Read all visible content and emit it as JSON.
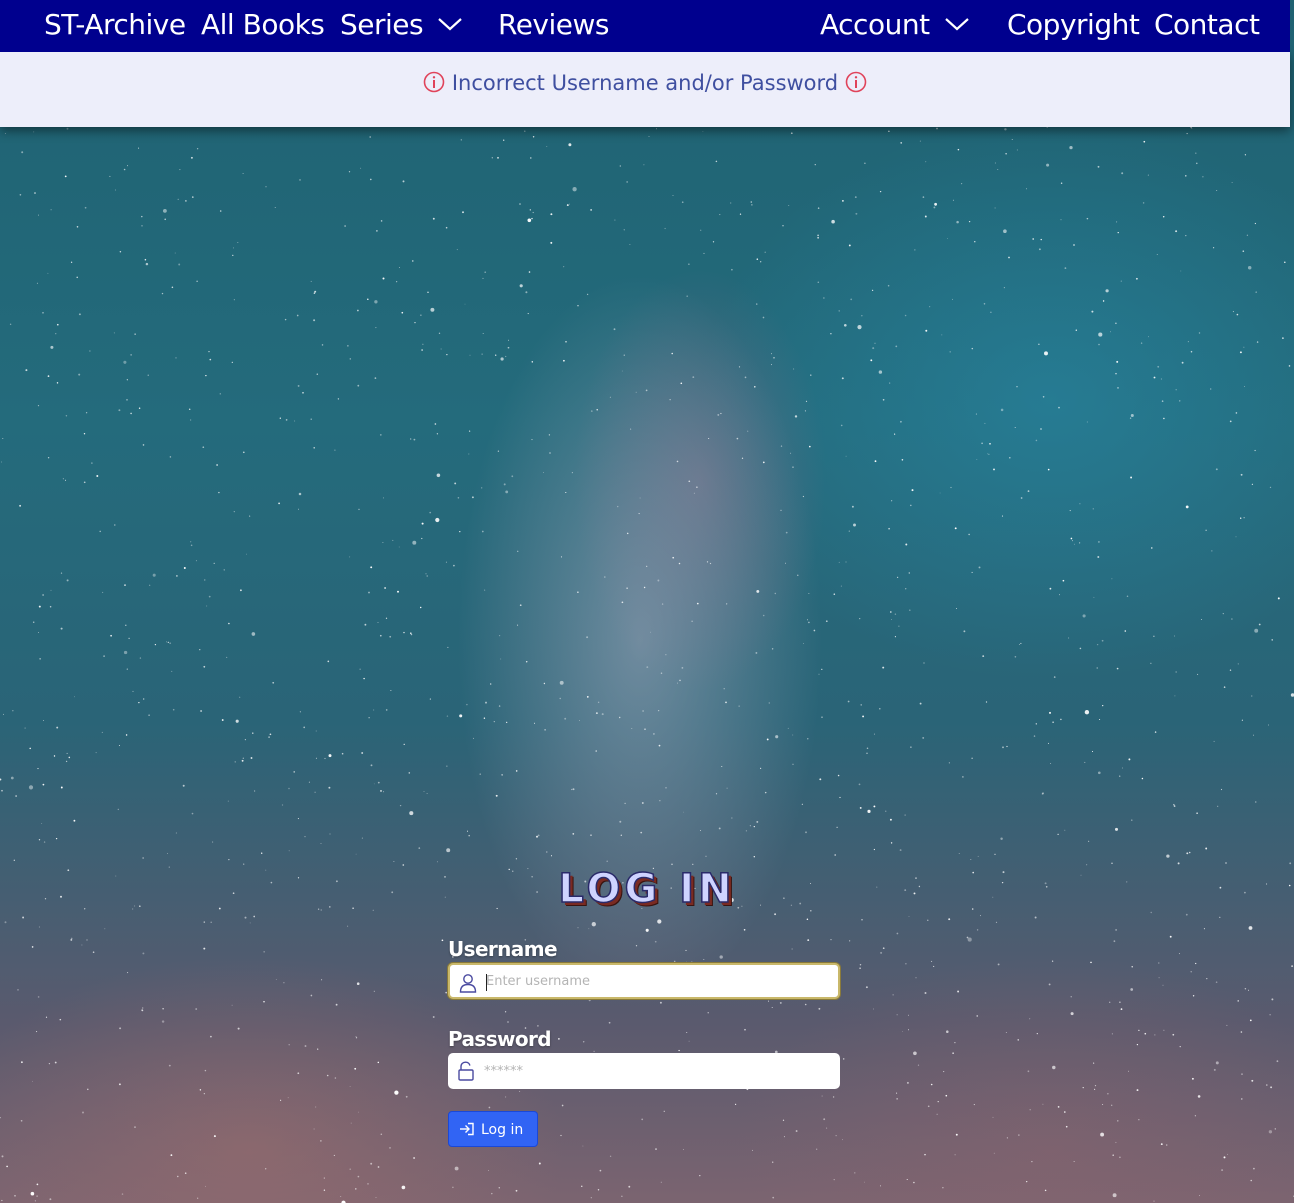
{
  "navbar": {
    "brand": "ST-Archive",
    "all_books": "All Books",
    "series": "Series",
    "reviews": "Reviews",
    "account": "Account",
    "copyright": "Copyright",
    "contact": "Contact",
    "background_color": "#00008e"
  },
  "alert": {
    "message": "Incorrect Username and/or Password",
    "icon": "info-circle-icon",
    "icon_color": "#e0435a"
  },
  "login": {
    "title": "LOG IN",
    "username_label": "Username",
    "username_placeholder": "Enter username",
    "username_icon": "user-icon",
    "password_label": "Password",
    "password_placeholder": "******",
    "password_icon": "unlock-icon",
    "button_label": "Log in",
    "button_icon": "login-icon",
    "button_color": "#3164f4"
  }
}
